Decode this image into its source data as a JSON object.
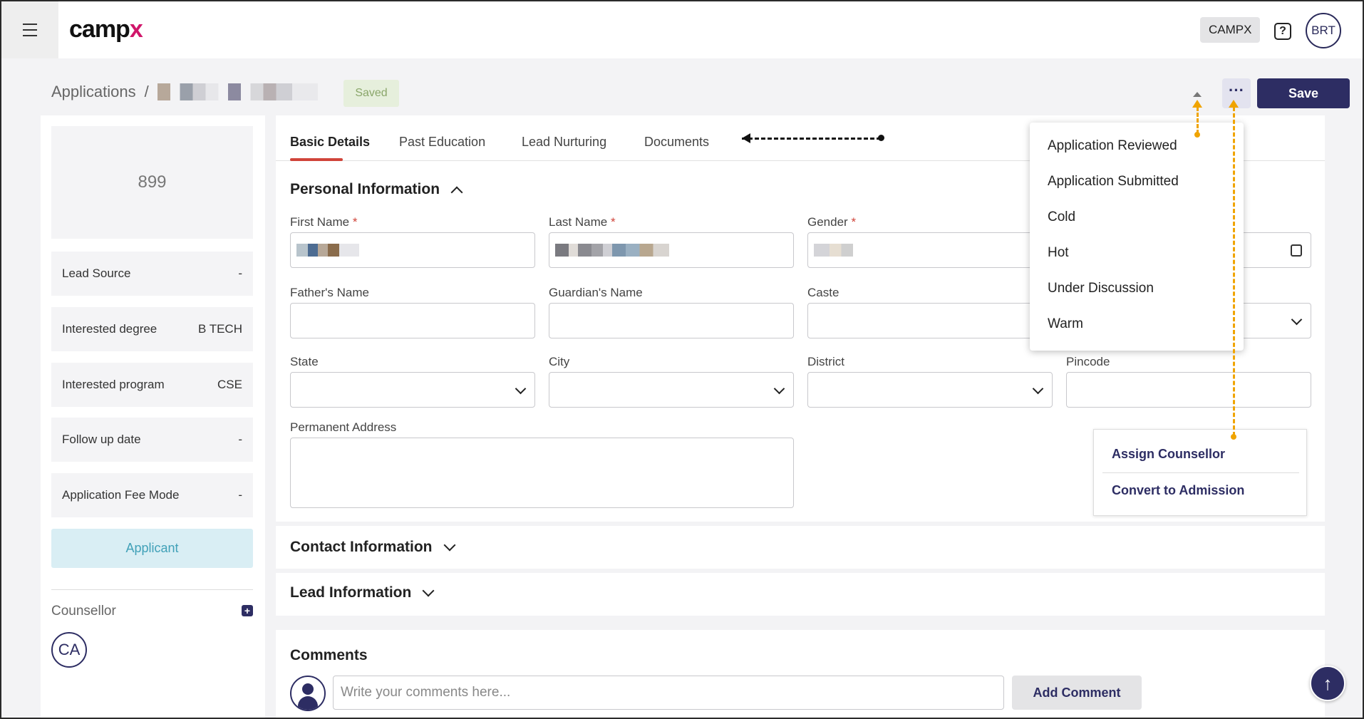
{
  "header": {
    "logo_main": "camp",
    "logo_x": "x",
    "org_badge": "CAMPX",
    "help_icon": "?",
    "user_initials": "BRT"
  },
  "breadcrumb": {
    "root": "Applications",
    "separator": "/",
    "status": "Saved"
  },
  "toolbar": {
    "more_label": "···",
    "save_label": "Save"
  },
  "sidebar": {
    "application_id": "899",
    "rows": [
      {
        "label": "Lead Source",
        "value": "-"
      },
      {
        "label": "Interested degree",
        "value": "B TECH"
      },
      {
        "label": "Interested program",
        "value": "CSE"
      },
      {
        "label": "Follow up date",
        "value": "-"
      },
      {
        "label": "Application Fee Mode",
        "value": "-"
      }
    ],
    "stage": "Applicant",
    "counsellor_label": "Counsellor",
    "counsellor_initials": "CA"
  },
  "tabs": [
    "Basic Details",
    "Past Education",
    "Lead Nurturing",
    "Documents"
  ],
  "personal": {
    "title": "Personal Information",
    "fields": {
      "first_name": "First Name",
      "last_name": "Last Name",
      "gender": "Gender",
      "fathers_name": "Father's Name",
      "guardians_name": "Guardian's Name",
      "caste": "Caste",
      "state": "State",
      "city": "City",
      "district": "District",
      "pincode": "Pincode",
      "permanent_address": "Permanent Address"
    },
    "required_mark": "*"
  },
  "status_dropdown": {
    "options": [
      "Application Reviewed",
      "Application Submitted",
      "Cold",
      "Hot",
      "Under Discussion",
      "Warm"
    ]
  },
  "more_menu": {
    "items": [
      "Assign Counsellor",
      "Convert to Admission"
    ]
  },
  "sections": {
    "contact": "Contact Information",
    "lead": "Lead Information"
  },
  "comments": {
    "title": "Comments",
    "placeholder": "Write your comments here...",
    "add_label": "Add Comment"
  },
  "colors": {
    "primary": "#2d2d63",
    "accent_tab": "#d0443a",
    "annotation": "#f0a400",
    "saved_bg": "#e6efdc",
    "applicant_bg": "#d9eef4"
  }
}
